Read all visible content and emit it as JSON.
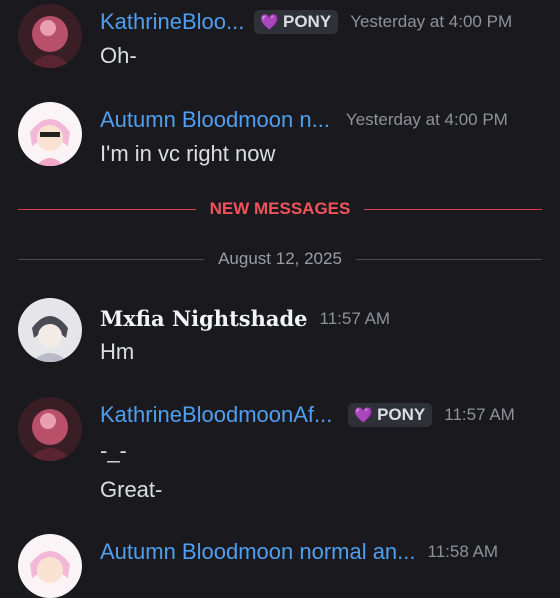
{
  "messages": [
    {
      "author": "KathrineBloo...",
      "tag": "PONY",
      "time": "Yesterday at 4:00 PM",
      "lines": [
        "Oh-"
      ]
    },
    {
      "author": "Autumn Bloodmoon n...",
      "time": "Yesterday at 4:00 PM",
      "lines": [
        "I'm in vc right now"
      ]
    },
    {
      "author": "Mxfia Nightshade",
      "time": "11:57 AM",
      "lines": [
        "Hm"
      ]
    },
    {
      "author": "KathrineBloodmoonAf...",
      "tag": "PONY",
      "time": "11:57 AM",
      "lines": [
        "-_-",
        "Great-"
      ]
    },
    {
      "author": "Autumn Bloodmoon normal an...",
      "time": "11:58 AM",
      "lines": []
    }
  ],
  "dividers": {
    "new_messages": "NEW MESSAGES",
    "date": "August 12, 2025"
  },
  "icons": {
    "tag_icon": "purple-heart-icon"
  },
  "colors": {
    "background": "#1a1a1e",
    "username": "#4f9ff0",
    "new_messages": "#f0535c",
    "tag_heart": "#c98de6"
  }
}
